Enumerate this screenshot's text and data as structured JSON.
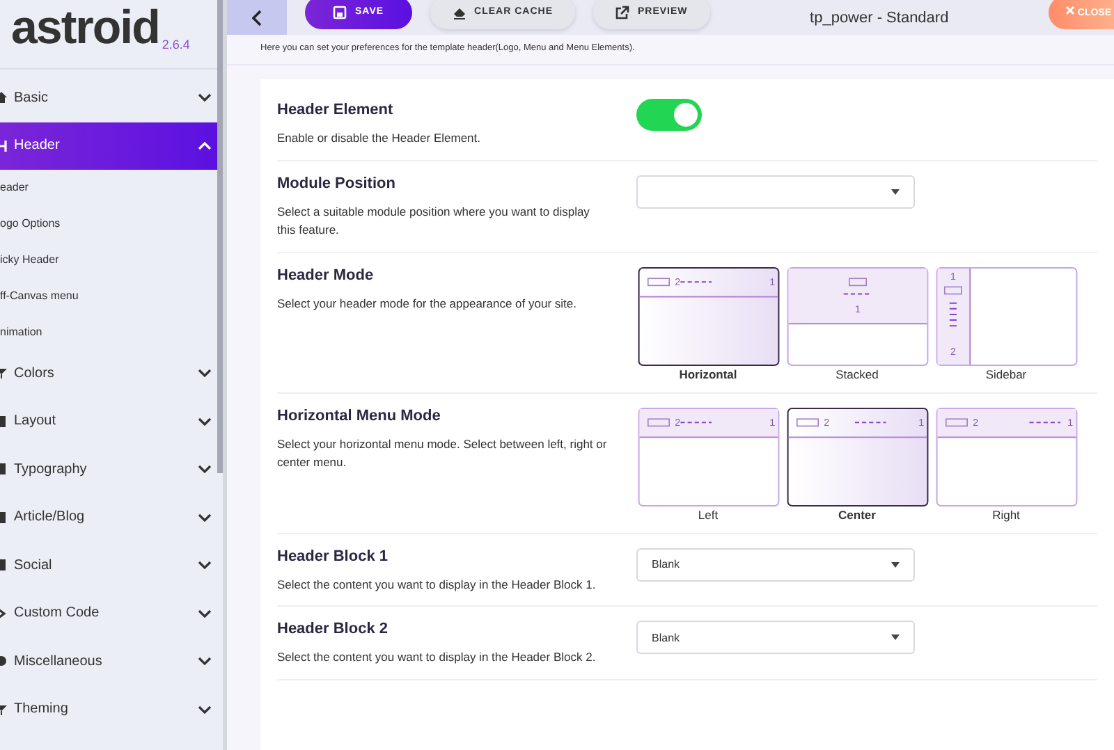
{
  "app": {
    "logo": "astroid",
    "version": "2.6.4"
  },
  "toolbar": {
    "buttons": [
      {
        "label": "SAVE",
        "kind": "save"
      },
      {
        "label": "CLEAR CACHE",
        "kind": "clear"
      },
      {
        "label": "PREVIEW",
        "kind": "preview"
      }
    ],
    "title": "tp_power - Standard",
    "close": "CLOSE"
  },
  "sidebar": {
    "items": [
      {
        "label": "Basic",
        "selected": false,
        "expanded": false
      },
      {
        "label": "Header",
        "selected": true,
        "expanded": true,
        "children": [
          {
            "label": "eader"
          },
          {
            "label": "ogo Options"
          },
          {
            "label": "icky Header"
          },
          {
            "label": "ff-Canvas menu"
          },
          {
            "label": "nimation"
          }
        ]
      },
      {
        "label": "Colors",
        "selected": false,
        "expanded": false
      },
      {
        "label": "Layout",
        "selected": false,
        "expanded": false
      },
      {
        "label": "Typography",
        "selected": false,
        "expanded": false
      },
      {
        "label": "Article/Blog",
        "selected": false,
        "expanded": false
      },
      {
        "label": "Social",
        "selected": false,
        "expanded": false
      },
      {
        "label": "Custom Code",
        "selected": false,
        "expanded": false
      },
      {
        "label": "Miscellaneous",
        "selected": false,
        "expanded": false
      },
      {
        "label": "Theming",
        "selected": false,
        "expanded": false
      }
    ]
  },
  "intro": "Here you can set your preferences for the template header(Logo, Menu and Menu Elements).",
  "settings": [
    {
      "kind": "toggle",
      "title": "Header Element",
      "description": "Enable or disable the Header Element.",
      "on": true
    },
    {
      "kind": "select",
      "title": "Module Position",
      "description": "Select a suitable module position where you want to display this feature."
    },
    {
      "kind": "options",
      "title": "Header Mode",
      "description": "Select your header mode for the appearance of your site.",
      "options": [
        {
          "label": "Horizontal",
          "kind": "horizontal",
          "marks": [
            "2",
            "1"
          ],
          "selected": true
        },
        {
          "label": "Stacked",
          "kind": "stacked",
          "marks": [
            "1"
          ],
          "selected": false
        },
        {
          "label": "Sidebar",
          "kind": "sidebar",
          "marks": [
            "1",
            "2"
          ],
          "selected": false
        }
      ]
    },
    {
      "kind": "options",
      "title": "Horizontal Menu Mode",
      "description": "Select your horizontal menu mode. Select between left, right or center menu.",
      "options": [
        {
          "label": "Left",
          "kind": "left",
          "marks": [
            "2",
            "1"
          ],
          "selected": false
        },
        {
          "label": "Center",
          "kind": "center",
          "marks": [
            "2",
            "1"
          ],
          "selected": true
        },
        {
          "label": "Right",
          "kind": "right",
          "marks": [
            "2",
            "1"
          ],
          "selected": false
        }
      ]
    },
    {
      "kind": "select",
      "title": "Header Block 1",
      "description": "Select the content you want to display in the Header Block 1.",
      "value": "Blank"
    },
    {
      "kind": "select",
      "title": "Header Block 2",
      "description": "Select the content you want to display in the Header Block 2.",
      "value": "Blank"
    }
  ]
}
